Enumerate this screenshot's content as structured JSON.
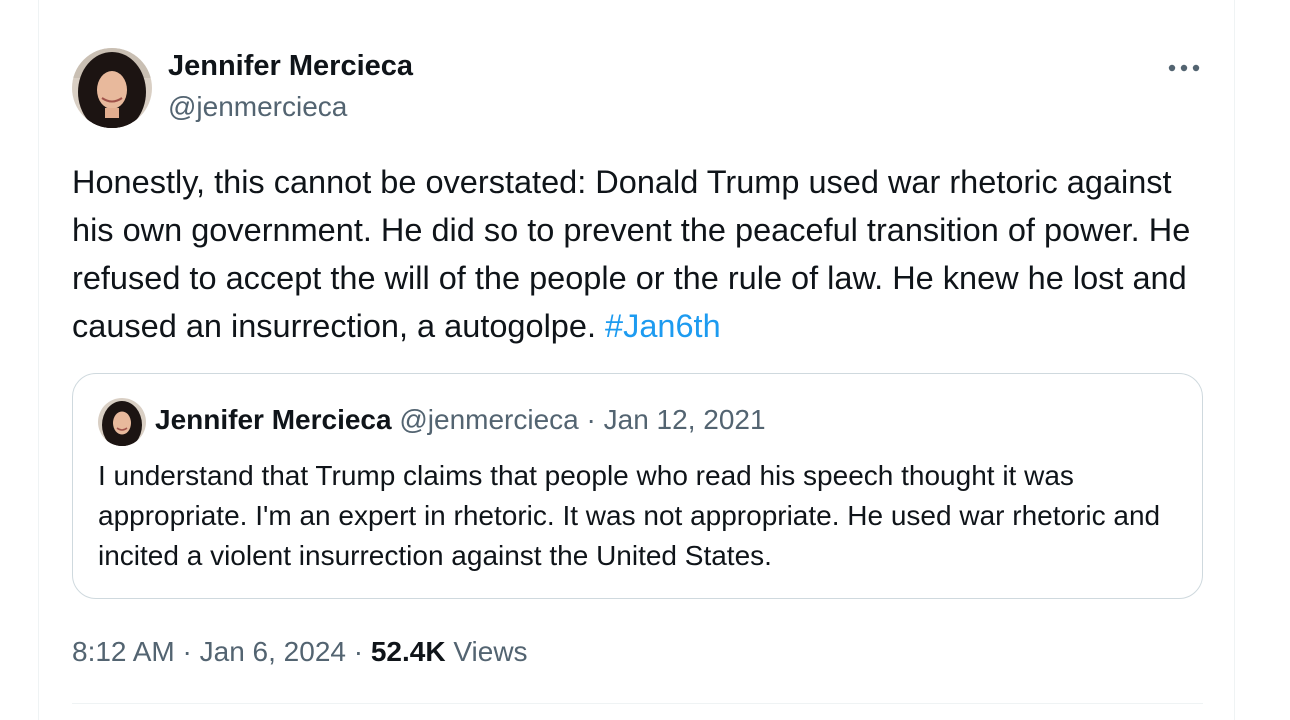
{
  "tweet": {
    "author_name": "Jennifer Mercieca",
    "author_handle": "@jenmercieca",
    "text": "Honestly, this cannot be overstated: Donald Trump used war rhetoric against his own government. He did so to prevent the peaceful transition of power. He refused to accept the will of the people or the rule of law. He knew he lost and caused an insurrection, a autogolpe.",
    "hashtag": "#Jan6th",
    "more_icon": "more-horizontal-icon"
  },
  "quote": {
    "author_name": "Jennifer Mercieca",
    "author_handle": "@jenmercieca",
    "separator": "·",
    "date": "Jan 12, 2021",
    "text": "I understand that Trump claims that people who read his speech thought it was appropriate. I'm an expert in rhetoric. It was not appropriate. He used war rhetoric and incited a violent insurrection against the United States."
  },
  "footer": {
    "time": "8:12 AM",
    "separator": "·",
    "date": "Jan 6, 2024",
    "views_count": "52.4K",
    "views_label": "Views"
  },
  "colors": {
    "text": "#0f1419",
    "secondary": "#536471",
    "link": "#1d9bf0",
    "border": "#cfd9de"
  }
}
